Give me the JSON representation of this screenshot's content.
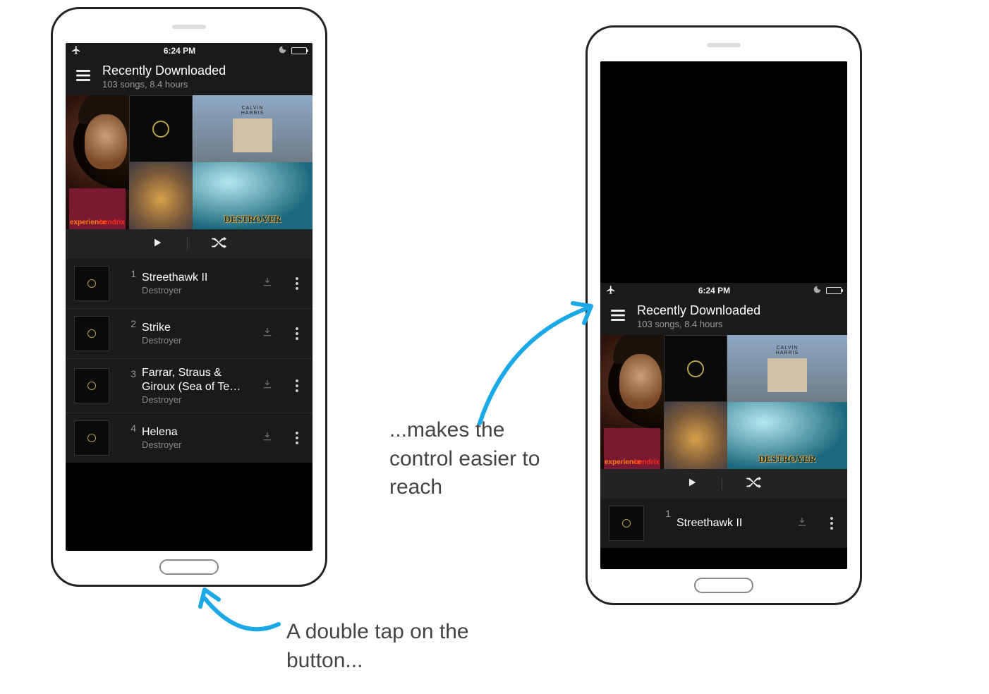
{
  "status": {
    "time": "6:24 PM"
  },
  "header": {
    "title": "Recently Downloaded",
    "subtitle": "103 songs, 8.4 hours"
  },
  "art": {
    "calvin_line1": "CALVIN",
    "calvin_line2": "HARRIS",
    "destroyer_blue": "DESTROYER",
    "hendrix_left": "experience",
    "hendrix_right": "hendrix"
  },
  "songs": [
    {
      "n": "1",
      "title": "Streethawk II",
      "artist": "Destroyer"
    },
    {
      "n": "2",
      "title": "Strike",
      "artist": "Destroyer"
    },
    {
      "n": "3",
      "title": "Farrar, Straus & Giroux (Sea of Te…",
      "artist": "Destroyer"
    },
    {
      "n": "4",
      "title": "Helena",
      "artist": "Destroyer"
    }
  ],
  "annotation_left": "A double tap on the button...",
  "annotation_right": "...makes the control easier to reach"
}
